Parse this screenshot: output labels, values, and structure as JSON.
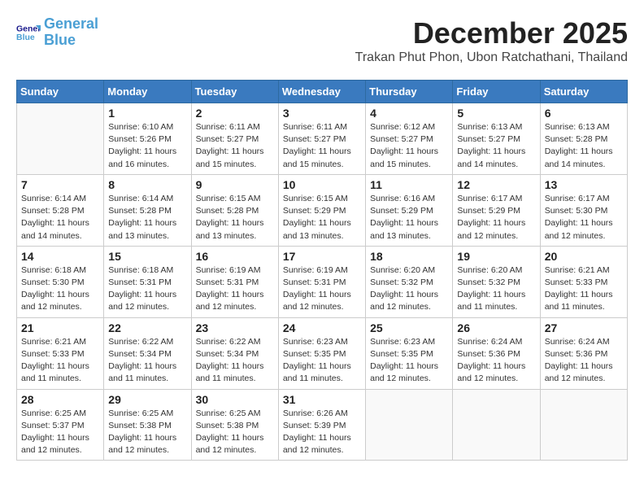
{
  "header": {
    "logo_line1": "General",
    "logo_line2": "Blue",
    "month": "December 2025",
    "location": "Trakan Phut Phon, Ubon Ratchathani, Thailand"
  },
  "weekdays": [
    "Sunday",
    "Monday",
    "Tuesday",
    "Wednesday",
    "Thursday",
    "Friday",
    "Saturday"
  ],
  "weeks": [
    [
      {
        "day": "",
        "info": ""
      },
      {
        "day": "1",
        "info": "Sunrise: 6:10 AM\nSunset: 5:26 PM\nDaylight: 11 hours\nand 16 minutes."
      },
      {
        "day": "2",
        "info": "Sunrise: 6:11 AM\nSunset: 5:27 PM\nDaylight: 11 hours\nand 15 minutes."
      },
      {
        "day": "3",
        "info": "Sunrise: 6:11 AM\nSunset: 5:27 PM\nDaylight: 11 hours\nand 15 minutes."
      },
      {
        "day": "4",
        "info": "Sunrise: 6:12 AM\nSunset: 5:27 PM\nDaylight: 11 hours\nand 15 minutes."
      },
      {
        "day": "5",
        "info": "Sunrise: 6:13 AM\nSunset: 5:27 PM\nDaylight: 11 hours\nand 14 minutes."
      },
      {
        "day": "6",
        "info": "Sunrise: 6:13 AM\nSunset: 5:28 PM\nDaylight: 11 hours\nand 14 minutes."
      }
    ],
    [
      {
        "day": "7",
        "info": "Sunrise: 6:14 AM\nSunset: 5:28 PM\nDaylight: 11 hours\nand 14 minutes."
      },
      {
        "day": "8",
        "info": "Sunrise: 6:14 AM\nSunset: 5:28 PM\nDaylight: 11 hours\nand 13 minutes."
      },
      {
        "day": "9",
        "info": "Sunrise: 6:15 AM\nSunset: 5:28 PM\nDaylight: 11 hours\nand 13 minutes."
      },
      {
        "day": "10",
        "info": "Sunrise: 6:15 AM\nSunset: 5:29 PM\nDaylight: 11 hours\nand 13 minutes."
      },
      {
        "day": "11",
        "info": "Sunrise: 6:16 AM\nSunset: 5:29 PM\nDaylight: 11 hours\nand 13 minutes."
      },
      {
        "day": "12",
        "info": "Sunrise: 6:17 AM\nSunset: 5:29 PM\nDaylight: 11 hours\nand 12 minutes."
      },
      {
        "day": "13",
        "info": "Sunrise: 6:17 AM\nSunset: 5:30 PM\nDaylight: 11 hours\nand 12 minutes."
      }
    ],
    [
      {
        "day": "14",
        "info": "Sunrise: 6:18 AM\nSunset: 5:30 PM\nDaylight: 11 hours\nand 12 minutes."
      },
      {
        "day": "15",
        "info": "Sunrise: 6:18 AM\nSunset: 5:31 PM\nDaylight: 11 hours\nand 12 minutes."
      },
      {
        "day": "16",
        "info": "Sunrise: 6:19 AM\nSunset: 5:31 PM\nDaylight: 11 hours\nand 12 minutes."
      },
      {
        "day": "17",
        "info": "Sunrise: 6:19 AM\nSunset: 5:31 PM\nDaylight: 11 hours\nand 12 minutes."
      },
      {
        "day": "18",
        "info": "Sunrise: 6:20 AM\nSunset: 5:32 PM\nDaylight: 11 hours\nand 12 minutes."
      },
      {
        "day": "19",
        "info": "Sunrise: 6:20 AM\nSunset: 5:32 PM\nDaylight: 11 hours\nand 11 minutes."
      },
      {
        "day": "20",
        "info": "Sunrise: 6:21 AM\nSunset: 5:33 PM\nDaylight: 11 hours\nand 11 minutes."
      }
    ],
    [
      {
        "day": "21",
        "info": "Sunrise: 6:21 AM\nSunset: 5:33 PM\nDaylight: 11 hours\nand 11 minutes."
      },
      {
        "day": "22",
        "info": "Sunrise: 6:22 AM\nSunset: 5:34 PM\nDaylight: 11 hours\nand 11 minutes."
      },
      {
        "day": "23",
        "info": "Sunrise: 6:22 AM\nSunset: 5:34 PM\nDaylight: 11 hours\nand 11 minutes."
      },
      {
        "day": "24",
        "info": "Sunrise: 6:23 AM\nSunset: 5:35 PM\nDaylight: 11 hours\nand 11 minutes."
      },
      {
        "day": "25",
        "info": "Sunrise: 6:23 AM\nSunset: 5:35 PM\nDaylight: 11 hours\nand 12 minutes."
      },
      {
        "day": "26",
        "info": "Sunrise: 6:24 AM\nSunset: 5:36 PM\nDaylight: 11 hours\nand 12 minutes."
      },
      {
        "day": "27",
        "info": "Sunrise: 6:24 AM\nSunset: 5:36 PM\nDaylight: 11 hours\nand 12 minutes."
      }
    ],
    [
      {
        "day": "28",
        "info": "Sunrise: 6:25 AM\nSunset: 5:37 PM\nDaylight: 11 hours\nand 12 minutes."
      },
      {
        "day": "29",
        "info": "Sunrise: 6:25 AM\nSunset: 5:38 PM\nDaylight: 11 hours\nand 12 minutes."
      },
      {
        "day": "30",
        "info": "Sunrise: 6:25 AM\nSunset: 5:38 PM\nDaylight: 11 hours\nand 12 minutes."
      },
      {
        "day": "31",
        "info": "Sunrise: 6:26 AM\nSunset: 5:39 PM\nDaylight: 11 hours\nand 12 minutes."
      },
      {
        "day": "",
        "info": ""
      },
      {
        "day": "",
        "info": ""
      },
      {
        "day": "",
        "info": ""
      }
    ]
  ]
}
